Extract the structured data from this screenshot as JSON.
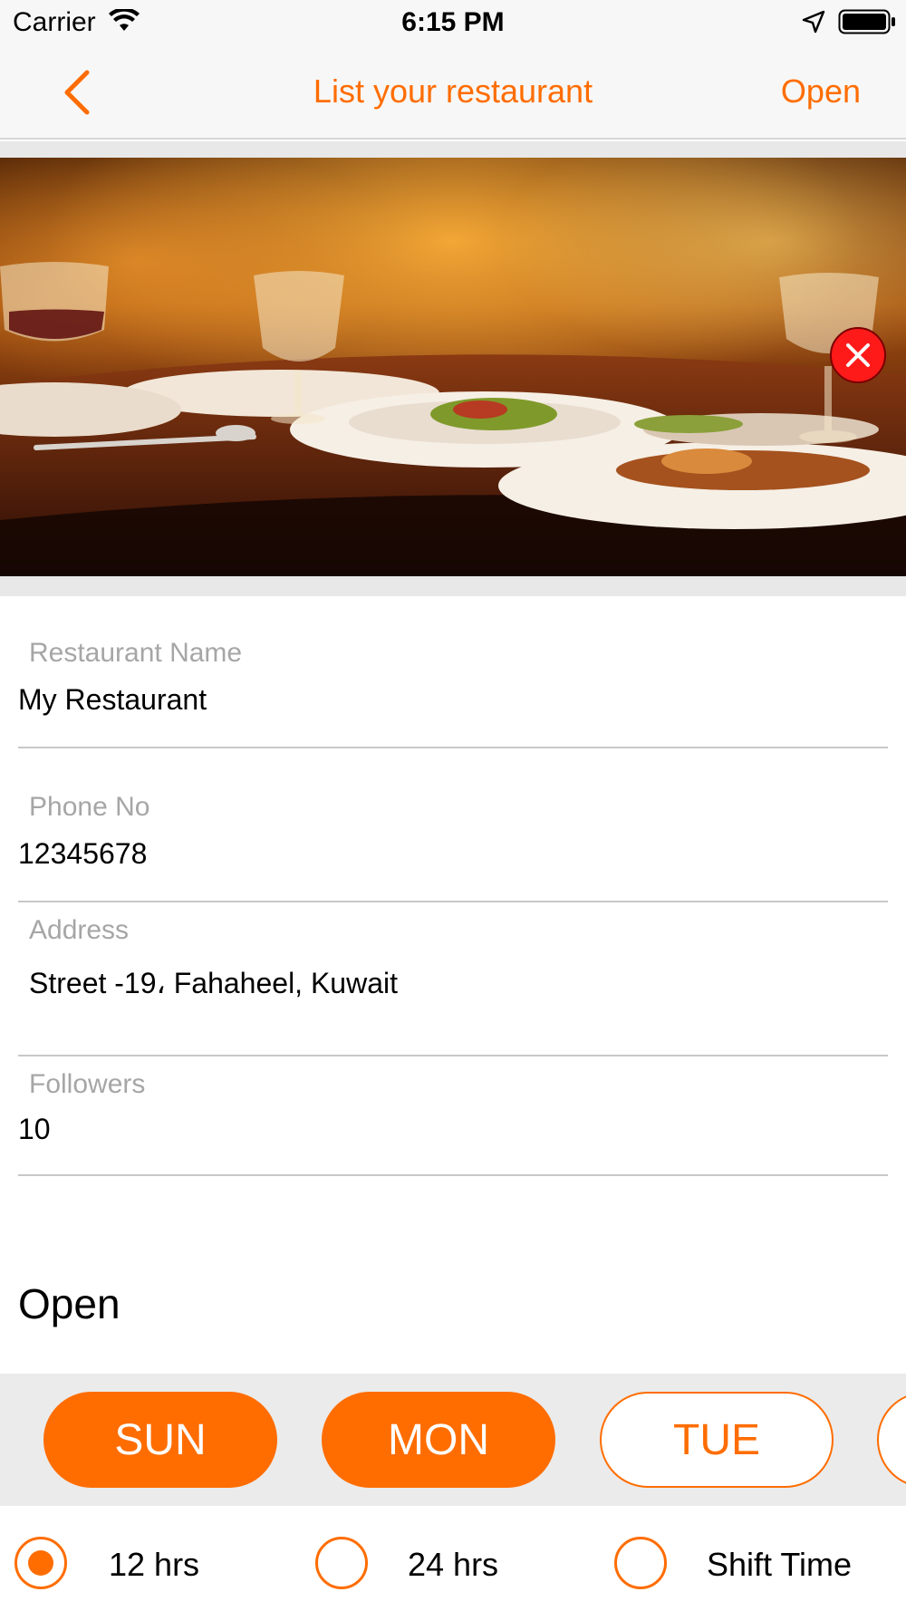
{
  "status_bar": {
    "carrier": "Carrier",
    "time": "6:15 PM",
    "icons": [
      "wifi-icon",
      "location-arrow-icon",
      "battery-icon"
    ]
  },
  "nav": {
    "back_icon": "chevron-left-icon",
    "title": "List your restaurant",
    "right_action": "Open"
  },
  "hero": {
    "image_desc": "restaurant-table-photo",
    "remove_icon": "close-icon"
  },
  "form": {
    "restaurant_name": {
      "label": "Restaurant Name",
      "value": "My Restaurant"
    },
    "phone": {
      "label": "Phone No",
      "value": "12345678"
    },
    "address": {
      "label": "Address",
      "value": "Street -19، Fahaheel, Kuwait"
    },
    "followers": {
      "label": "Followers",
      "value": "10"
    }
  },
  "open_section": {
    "title": "Open",
    "days": [
      {
        "label": "SUN",
        "selected": true
      },
      {
        "label": "MON",
        "selected": true
      },
      {
        "label": "TUE",
        "selected": false
      }
    ],
    "hour_options": [
      {
        "label": "12 hrs",
        "selected": true
      },
      {
        "label": "24 hrs",
        "selected": false
      },
      {
        "label": "Shift Time",
        "selected": false
      }
    ]
  },
  "colors": {
    "accent": "#ff6d00",
    "remove_button": "#ff1a1a",
    "label_gray": "#a6a6a6",
    "divider": "#c8c8c8"
  }
}
